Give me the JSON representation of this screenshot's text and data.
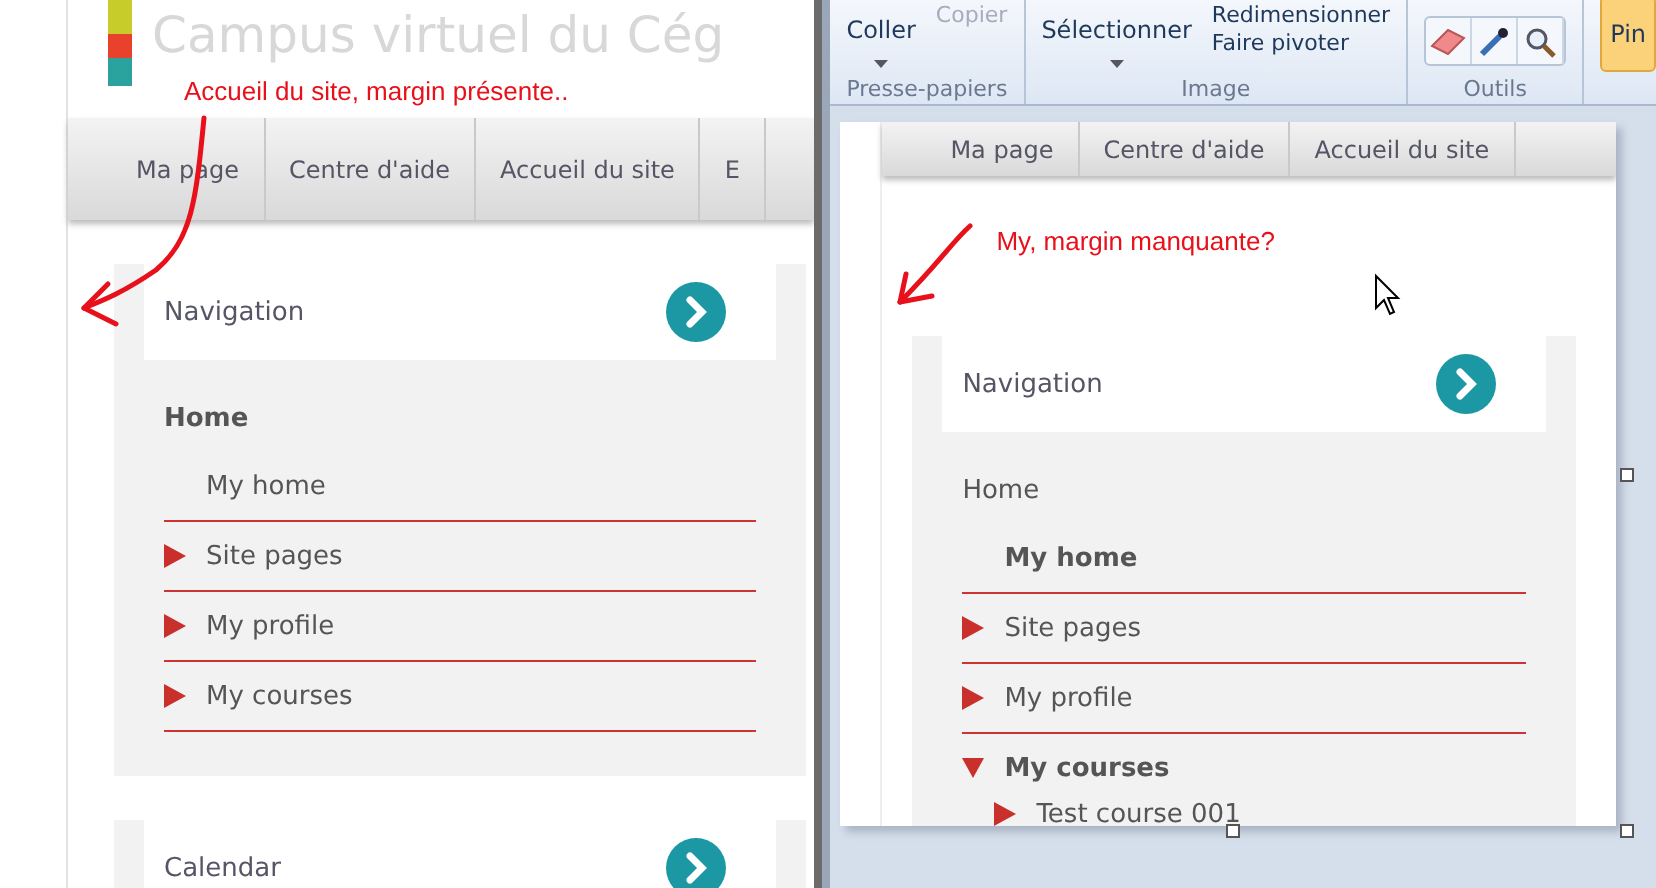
{
  "left_page": {
    "site_title": "Campus virtuel du Cég",
    "annotation": "Accueil du site, margin présente..",
    "nav_menu": [
      "Ma page",
      "Centre d'aide",
      "Accueil du site",
      "E"
    ],
    "blocks": [
      {
        "title": "Navigation",
        "tree": [
          {
            "label": "Home",
            "kind": "root",
            "bold": true
          },
          {
            "label": "My home",
            "kind": "leaf",
            "bold": false
          },
          {
            "label": "Site pages",
            "kind": "branch",
            "expanded": false,
            "bold": false
          },
          {
            "label": "My profile",
            "kind": "branch",
            "expanded": false,
            "bold": false
          },
          {
            "label": "My courses",
            "kind": "branch",
            "expanded": false,
            "bold": false
          }
        ]
      },
      {
        "title": "Calendar"
      }
    ]
  },
  "paint_window": {
    "ribbon_groups": [
      {
        "label": "Presse-papiers",
        "buttons": [
          {
            "label": "Coller",
            "kind": "large",
            "disabled": false
          },
          {
            "label": "Copier",
            "kind": "small",
            "disabled": true
          }
        ]
      },
      {
        "label": "Image",
        "buttons": [
          {
            "label": "Sélectionner",
            "kind": "large",
            "disabled": false
          },
          {
            "label": "Redimensionner",
            "kind": "small",
            "disabled": false
          },
          {
            "label": "Faire pivoter",
            "kind": "small",
            "disabled": false
          }
        ]
      },
      {
        "label": "Outils",
        "buttons": [
          {
            "kind": "eraser"
          },
          {
            "kind": "picker"
          },
          {
            "kind": "magnifier"
          }
        ]
      }
    ],
    "brush_button": "Pin",
    "canvas": {
      "nav_menu": [
        "Ma page",
        "Centre d'aide",
        "Accueil du site"
      ],
      "annotation": "My, margin manquante?",
      "block": {
        "title": "Navigation",
        "tree": [
          {
            "label": "Home",
            "kind": "root",
            "bold": false
          },
          {
            "label": "My home",
            "kind": "leaf",
            "bold": true
          },
          {
            "label": "Site pages",
            "kind": "branch",
            "expanded": false,
            "bold": false
          },
          {
            "label": "My profile",
            "kind": "branch",
            "expanded": false,
            "bold": false
          },
          {
            "label": "My courses",
            "kind": "branch",
            "expanded": true,
            "bold": true,
            "children": [
              {
                "label": "Test course 001",
                "kind": "branch",
                "expanded": false,
                "bold": false
              }
            ]
          }
        ]
      }
    }
  }
}
